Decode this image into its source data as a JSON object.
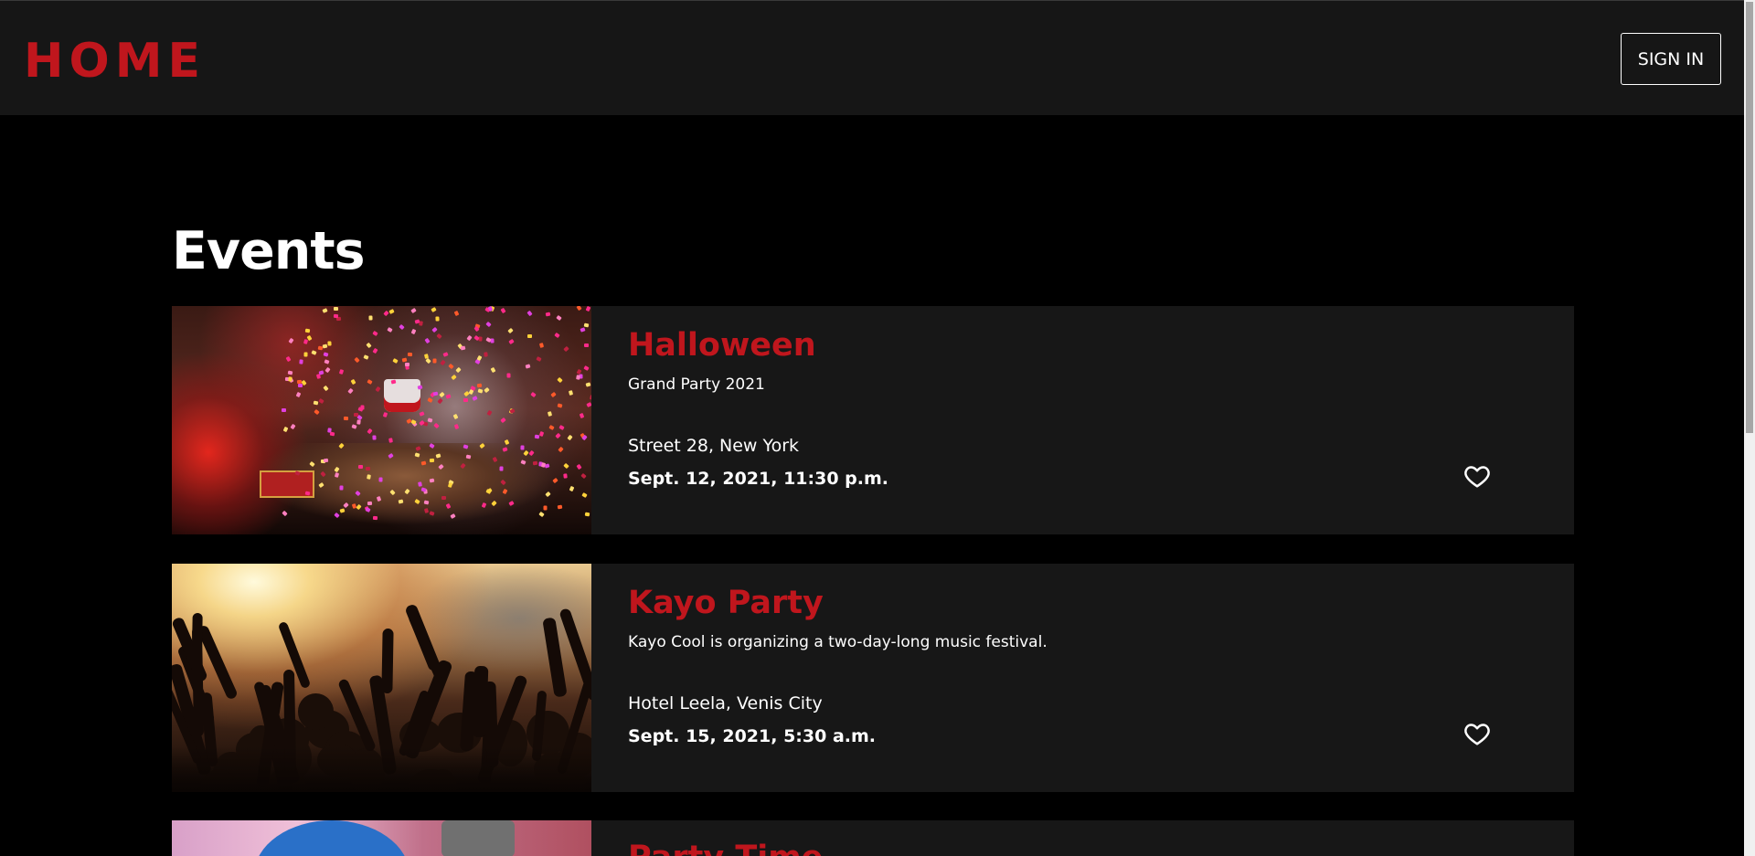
{
  "header": {
    "logo": "HOME",
    "signin_label": "SIGN IN"
  },
  "main": {
    "title": "Events",
    "events": [
      {
        "title": "Halloween",
        "subtitle": "Grand Party 2021",
        "location": "Street 28, New York",
        "datetime": "Sept. 12, 2021, 11:30 p.m.",
        "image": "confetti-stage-image",
        "favorite_icon": "heart-outline-icon"
      },
      {
        "title": "Kayo Party",
        "subtitle": "Kayo Cool is organizing a two-day-long music festival.",
        "location": "Hotel Leela, Venis City",
        "datetime": "Sept. 15, 2021, 5:30 a.m.",
        "image": "concert-crowd-image",
        "favorite_icon": "heart-outline-icon"
      },
      {
        "title": "Party Time",
        "subtitle": "",
        "location": "",
        "datetime": "",
        "image": "party-image",
        "favorite_icon": "heart-outline-icon"
      }
    ]
  },
  "colors": {
    "accent": "#c0161d",
    "header_bg": "#161616",
    "card_bg": "#171717",
    "page_bg": "#000000"
  }
}
